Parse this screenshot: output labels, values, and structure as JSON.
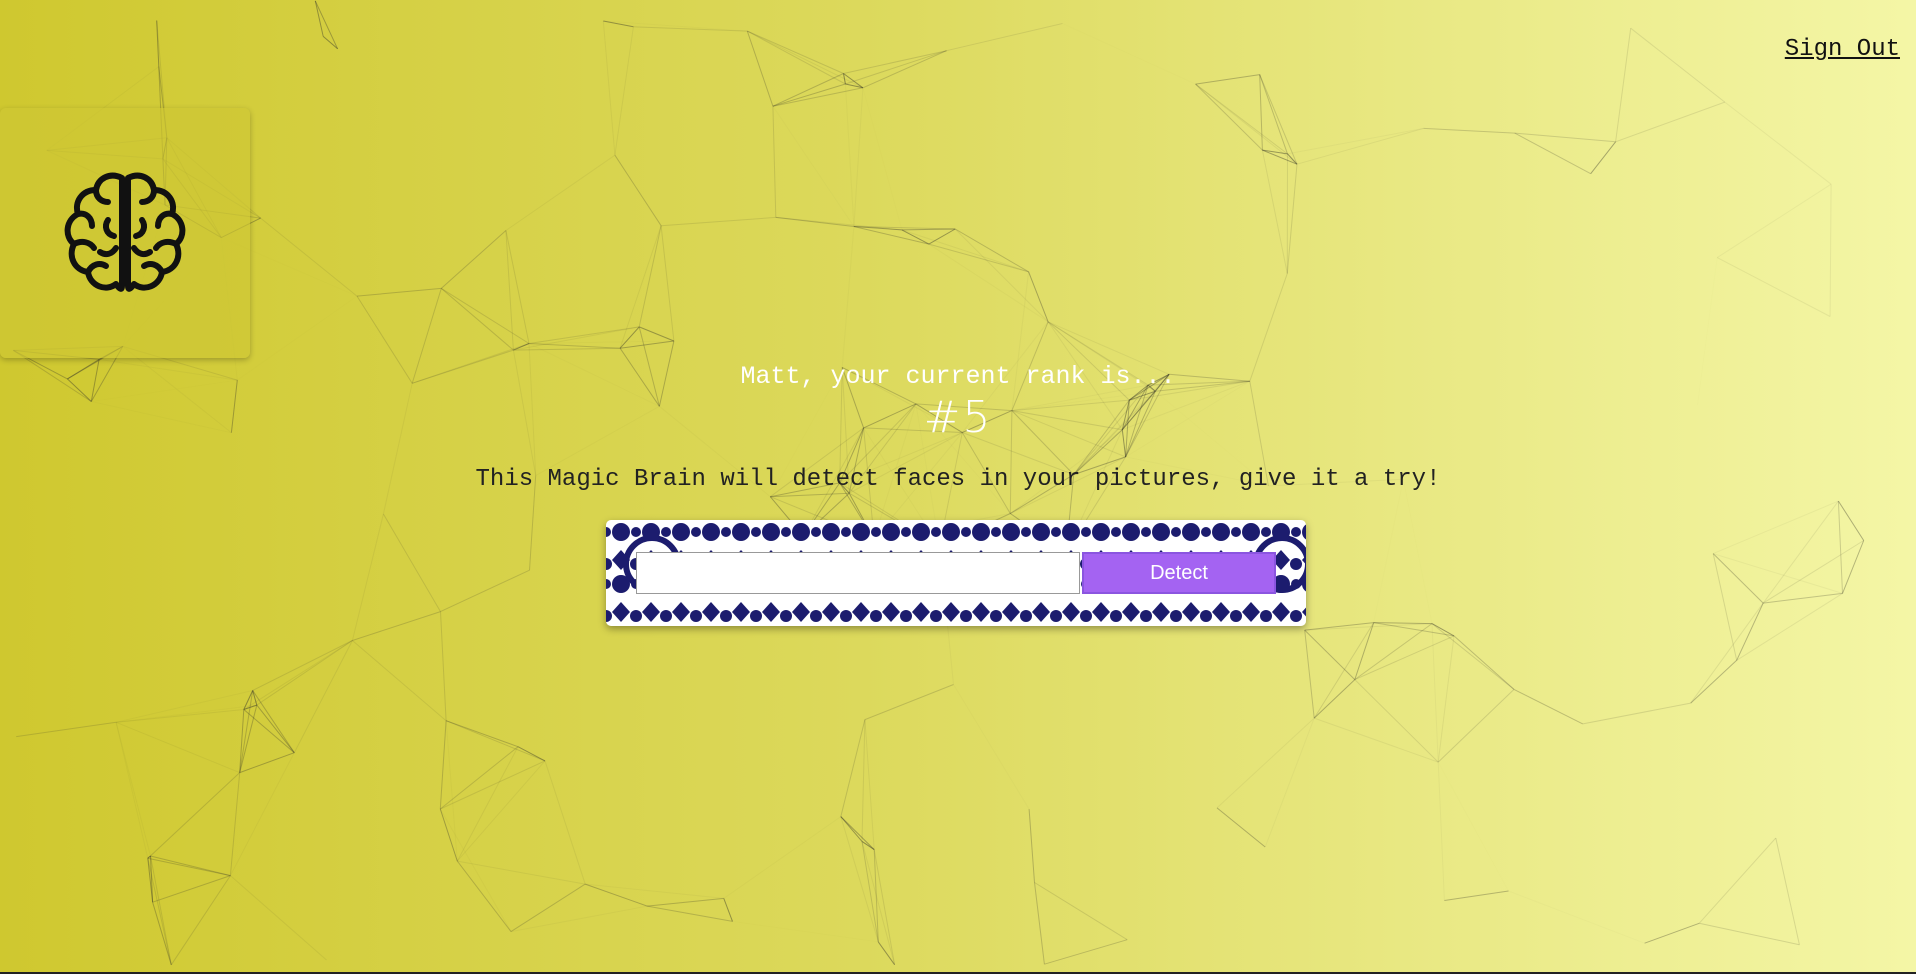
{
  "nav": {
    "sign_out_label": "Sign Out"
  },
  "logo": {
    "icon": "brain-icon"
  },
  "rank": {
    "message": "Matt, your current rank is...",
    "value": "#5"
  },
  "intro": {
    "text": "This Magic Brain will detect faces in your pictures, give it a try!"
  },
  "form": {
    "input_value": "",
    "button_label": "Detect"
  },
  "colors": {
    "background_start": "#cfc82f",
    "background_end": "#f4f6a6",
    "button": "#a463f2",
    "pattern": "#1c1c6e"
  }
}
